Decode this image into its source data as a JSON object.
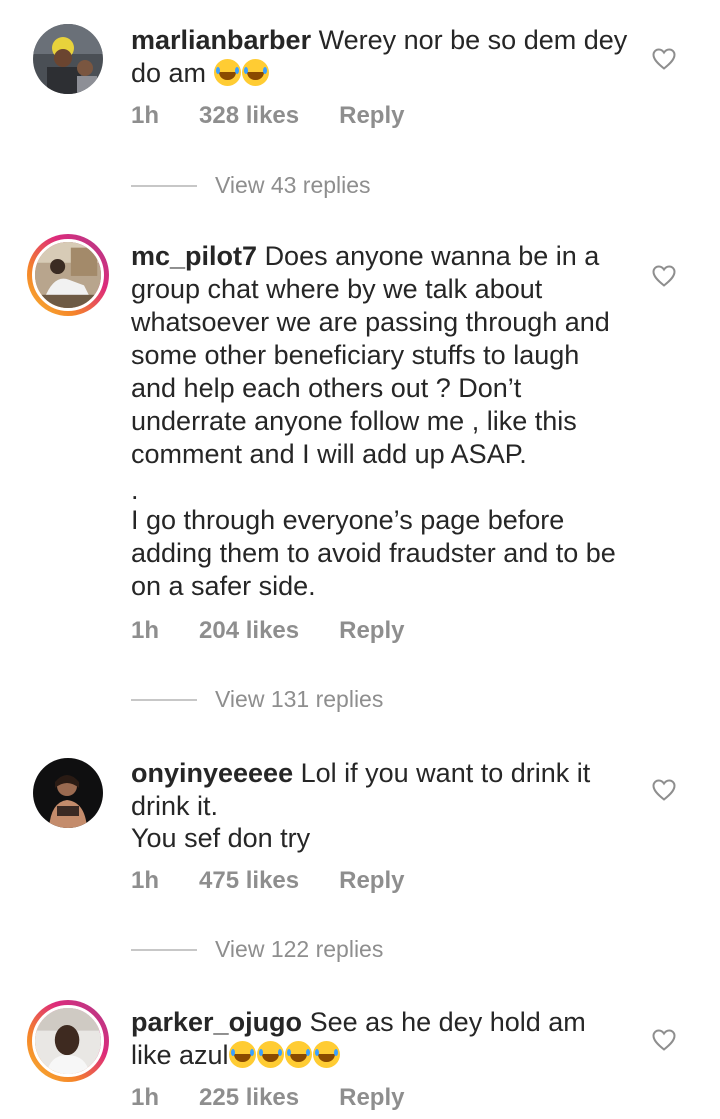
{
  "comments": [
    {
      "username": "marlianbarber",
      "text": "Werey nor be so dem dey do am",
      "emojis": "😂😂",
      "time": "1h",
      "likes": "328 likes",
      "reply": "Reply",
      "view_replies": "View 43 replies",
      "ring": false
    },
    {
      "username": "mc_pilot7",
      "text": "Does anyone wanna be in a group chat where by we talk about whatsoever we are passing through and some other beneficiary stuffs to laugh and help each others out ? Don’t underrate anyone follow me , like this comment and I will add up ASAP.",
      "text2": ".",
      "text3": "I go through everyone’s page before adding them to avoid fraudster and to be on a safer side.",
      "time": "1h",
      "likes": "204 likes",
      "reply": "Reply",
      "view_replies": "View 131 replies",
      "ring": true
    },
    {
      "username": "onyinyeeeee",
      "text": "Lol if you want to drink it drink it.",
      "text2": "You sef don try",
      "time": "1h",
      "likes": "475 likes",
      "reply": "Reply",
      "view_replies": "View 122 replies",
      "ring": false
    },
    {
      "username": "parker_ojugo",
      "text": "See as he dey hold am like azul",
      "emojis": "😂😂😂😂",
      "time": "1h",
      "likes": "225 likes",
      "reply": "Reply",
      "ring": true
    }
  ],
  "icons": {
    "like": "heart-outline-icon"
  },
  "colors": {
    "meta": "#8e8e8e",
    "text": "#262626",
    "ring_start": "#f7b733",
    "ring_end": "#c13584"
  }
}
